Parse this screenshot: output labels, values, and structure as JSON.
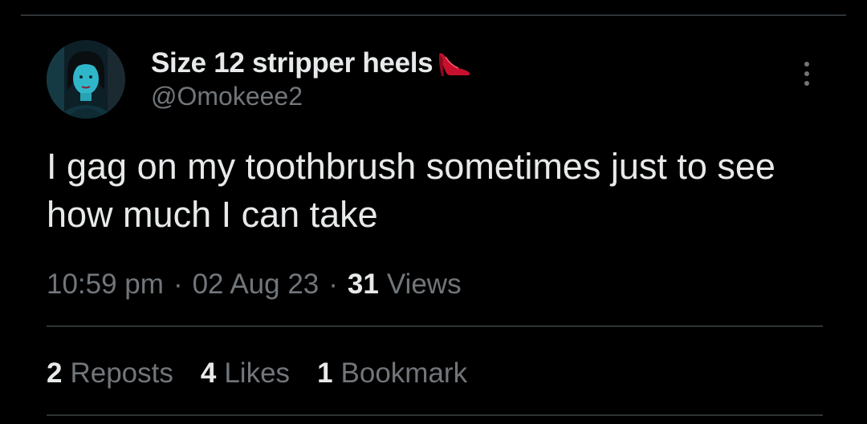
{
  "tweet": {
    "author": {
      "display_name": "Size 12 stripper heels",
      "emoji_icon": "high-heel-icon",
      "handle": "@Omokeee2"
    },
    "text": "I gag on my toothbrush sometimes just to see how much I can take",
    "meta": {
      "time": "10:59 pm",
      "separator": "·",
      "date": "02 Aug 23",
      "views_count": "31",
      "views_label": "Views"
    },
    "stats": {
      "reposts_count": "2",
      "reposts_label": "Reposts",
      "likes_count": "4",
      "likes_label": "Likes",
      "bookmarks_count": "1",
      "bookmarks_label": "Bookmark"
    }
  },
  "colors": {
    "background": "#000000",
    "primary_text": "#e7e9ea",
    "secondary_text": "#71767b",
    "divider": "#2f3336",
    "heel_red": "#c8102e"
  }
}
